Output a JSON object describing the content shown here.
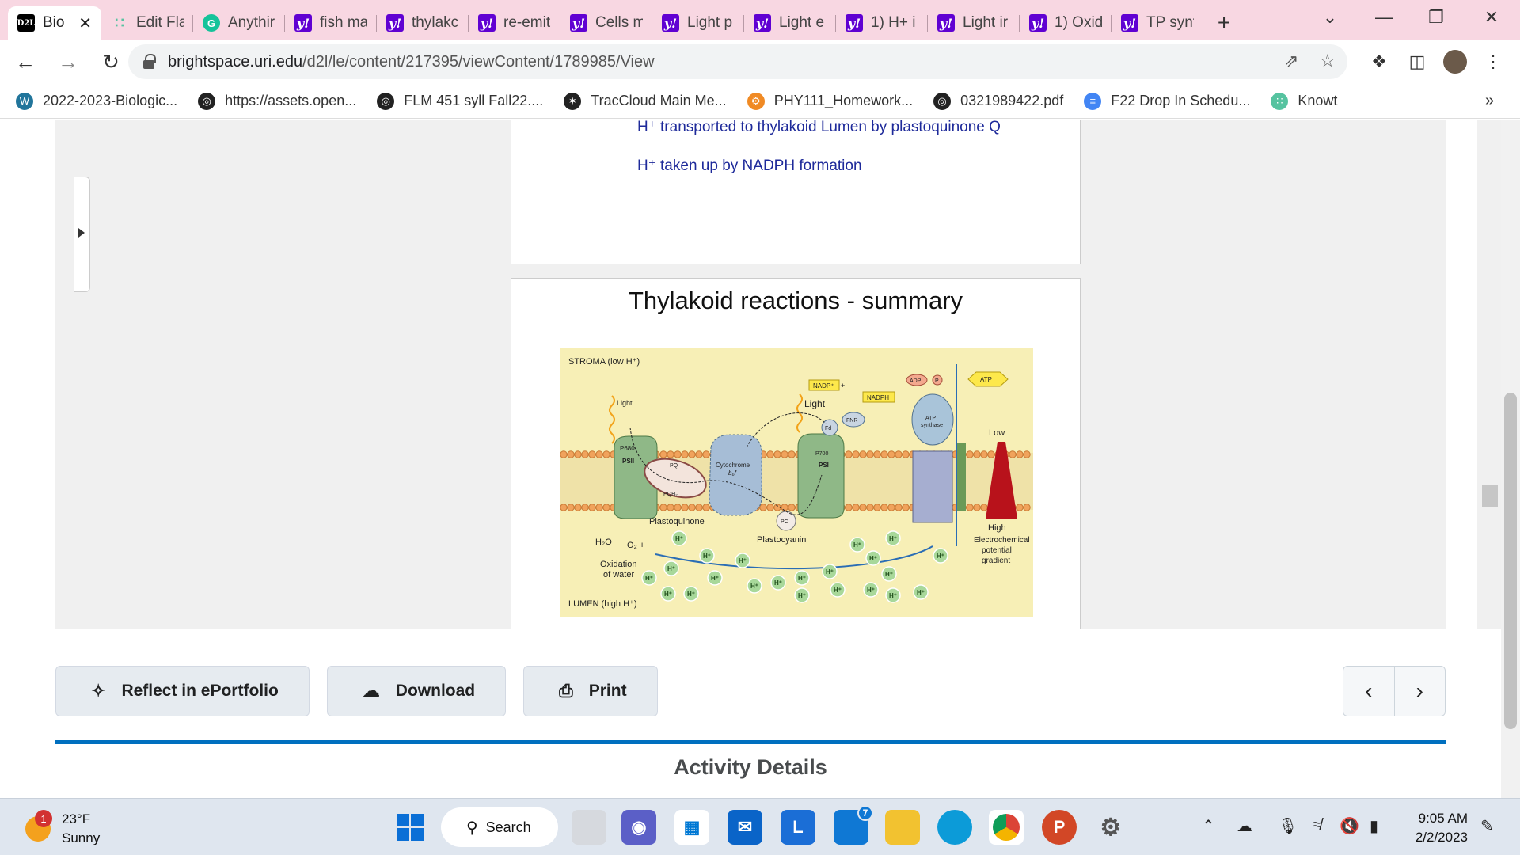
{
  "browser": {
    "tabs": [
      {
        "title": "Bio",
        "favicon": "d2l-icon",
        "active": true
      },
      {
        "title": "Edit Fla",
        "favicon": "knowt-icon"
      },
      {
        "title": "Anythir",
        "favicon": "grammarly-icon"
      },
      {
        "title": "fish ma",
        "favicon": "yahoo-icon"
      },
      {
        "title": "thylakc",
        "favicon": "yahoo-icon"
      },
      {
        "title": "re-emit",
        "favicon": "yahoo-icon"
      },
      {
        "title": "Cells m",
        "favicon": "yahoo-icon"
      },
      {
        "title": "Light p",
        "favicon": "yahoo-icon"
      },
      {
        "title": "Light e",
        "favicon": "yahoo-icon"
      },
      {
        "title": "1) H+ i",
        "favicon": "yahoo-icon"
      },
      {
        "title": "Light ir",
        "favicon": "yahoo-icon"
      },
      {
        "title": "1) Oxid",
        "favicon": "yahoo-icon"
      },
      {
        "title": "TP synt",
        "favicon": "yahoo-icon"
      }
    ],
    "url_host": "brightspace.uri.edu",
    "url_path": "/d2l/le/content/217395/viewContent/1789985/View",
    "bookmarks": [
      {
        "label": "2022-2023-Biologic...",
        "icon": "wordpress-icon",
        "color": "#21759b"
      },
      {
        "label": "https://assets.open...",
        "icon": "globe-icon",
        "color": "#222222"
      },
      {
        "label": "FLM 451 syll Fall22....",
        "icon": "globe-icon",
        "color": "#222222"
      },
      {
        "label": "TracCloud Main Me...",
        "icon": "traccloud-icon",
        "color": "#222222"
      },
      {
        "label": "PHY111_Homework...",
        "icon": "webassign-icon",
        "color": "#f08a24"
      },
      {
        "label": "0321989422.pdf",
        "icon": "globe-icon",
        "color": "#222222"
      },
      {
        "label": "F22 Drop In Schedu...",
        "icon": "docs-icon",
        "color": "#4285f4"
      },
      {
        "label": "Knowt",
        "icon": "knowt-icon",
        "color": "#56c3a0"
      }
    ]
  },
  "content": {
    "text_lines": [
      "H⁺ transported to thylakoid Lumen by plastoquinone Q",
      "H⁺ taken up by NADPH formation"
    ],
    "slide_title": "Thylakoid reactions - summary",
    "diagram": {
      "stroma": "STROMA (low H⁺)",
      "lumen": "LUMEN (high H⁺)",
      "light1": "Light",
      "light2": "Light",
      "psii": "PSII",
      "p680": "P680",
      "pq": "PQ",
      "pqh2": "PQH₂",
      "plastoquinone": "Plastoquinone",
      "cytochrome": "Cytochrome",
      "b6f": "b₆f",
      "pc": "PC",
      "plastocyanin": "Plastocyanin",
      "psi": "PSI",
      "p700": "P700",
      "fd": "Fd",
      "fnr": "FNR",
      "nadp": "NADP⁺",
      "plus_h": "+",
      "nadph": "NADPH",
      "atp_synthase_1": "ATP",
      "atp_synthase_2": "synthase",
      "adp": "ADP",
      "pi": "P",
      "atp": "ATP",
      "low": "Low",
      "high": "High",
      "gradient_1": "Electrochemical",
      "gradient_2": "potential",
      "gradient_3": "gradient",
      "water": "H₂O",
      "o2": "O₂ +",
      "oxidation_1": "Oxidation",
      "oxidation_2": "of water",
      "hplus": "H⁺",
      "e_minus": "e⁻"
    },
    "buttons": {
      "reflect": "Reflect in ePortfolio",
      "download": "Download",
      "print": "Print"
    },
    "activity_details": "Activity Details"
  },
  "taskbar": {
    "temperature": "23°F",
    "condition": "Sunny",
    "weather_badge": "1",
    "search": "Search",
    "time": "9:05 AM",
    "date": "2/2/2023",
    "outlook_badge": "7"
  }
}
